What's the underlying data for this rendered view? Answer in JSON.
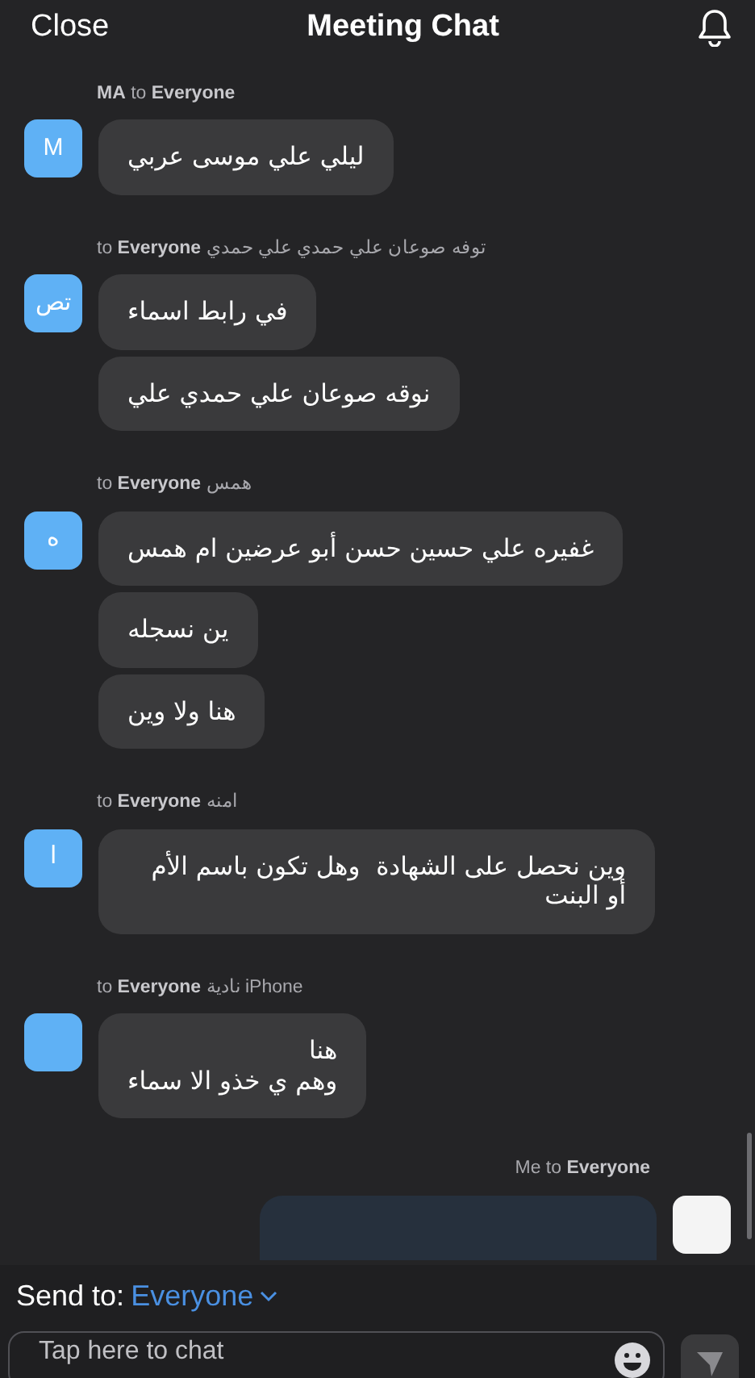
{
  "header": {
    "close": "Close",
    "title": "Meeting Chat"
  },
  "messages": [
    {
      "header": "**MA** to **Everyone**",
      "avatar": "M",
      "bubbles": [
        "ليلي علي موسى عربي"
      ]
    },
    {
      "header": "to **Everyone** توفه صوعان علي حمدي علي حمدي",
      "avatar": "تص",
      "bubbles": [
        "في رابط اسماء",
        "نوقه صوعان علي حمدي علي"
      ]
    },
    {
      "header": "to **Everyone** همس",
      "avatar": "ه",
      "bubbles": [
        "غفيره علي حسين حسن أبو عرضين ام همس",
        "ين نسجله",
        "هنا ولا وين"
      ]
    },
    {
      "header": "to **Everyone** امنه",
      "avatar": "ا",
      "bubbles": [
        "وين نحصل على الشهادة  وهل تكون باسم الأم أو البنت"
      ]
    },
    {
      "header": "to **Everyone** نادية iPhone",
      "bubbles": [
        "هنا\nوهم ي خذو الا سماء"
      ]
    }
  ],
  "own_message": {
    "header": "Me to **Everyone**"
  },
  "composer": {
    "send_to_label": "Send to:",
    "recipient": "Everyone",
    "placeholder": "Tap here to chat"
  }
}
